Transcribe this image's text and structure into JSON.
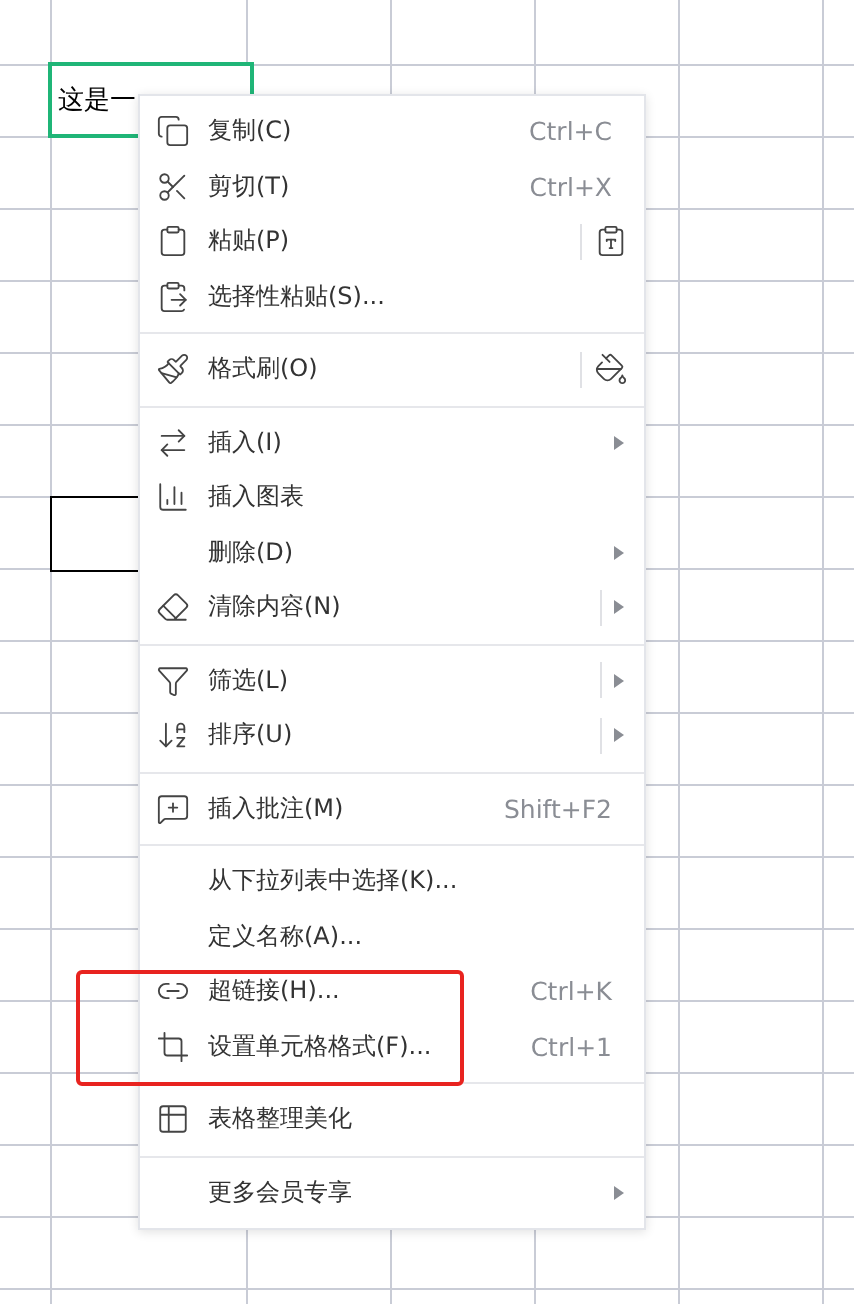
{
  "sheet": {
    "active_cell": {
      "text": "这是一"
    }
  },
  "menu": {
    "groups": [
      [
        {
          "label": "复制(C)",
          "kind": "shortcut",
          "shortcut": "Ctrl+C"
        },
        {
          "label": "剪切(T)",
          "kind": "shortcut",
          "shortcut": "Ctrl+X"
        },
        {
          "label": "粘贴(P)",
          "kind": "split_action"
        },
        {
          "label": "选择性粘贴(S)...",
          "kind": "plain"
        }
      ],
      [
        {
          "label": "格式刷(O)",
          "kind": "split_action"
        }
      ],
      [
        {
          "label": "插入(I)",
          "kind": "submenu"
        },
        {
          "label": "插入图表",
          "kind": "plain"
        },
        {
          "label": "删除(D)",
          "kind": "submenu"
        },
        {
          "label": "清除内容(N)",
          "kind": "split_submenu"
        }
      ],
      [
        {
          "label": "筛选(L)",
          "kind": "split_submenu"
        },
        {
          "label": "排序(U)",
          "kind": "split_submenu"
        }
      ],
      [
        {
          "label": "插入批注(M)",
          "kind": "shortcut",
          "shortcut": "Shift+F2"
        }
      ],
      [
        {
          "label": "从下拉列表中选择(K)...",
          "kind": "plain"
        },
        {
          "label": "定义名称(A)...",
          "kind": "plain"
        },
        {
          "label": "超链接(H)...",
          "kind": "shortcut",
          "shortcut": "Ctrl+K"
        },
        {
          "label": "设置单元格格式(F)...",
          "kind": "shortcut",
          "shortcut": "Ctrl+1"
        }
      ],
      [
        {
          "label": "表格整理美化",
          "kind": "plain"
        }
      ],
      [
        {
          "label": "更多会员专享",
          "kind": "submenu"
        }
      ]
    ]
  }
}
